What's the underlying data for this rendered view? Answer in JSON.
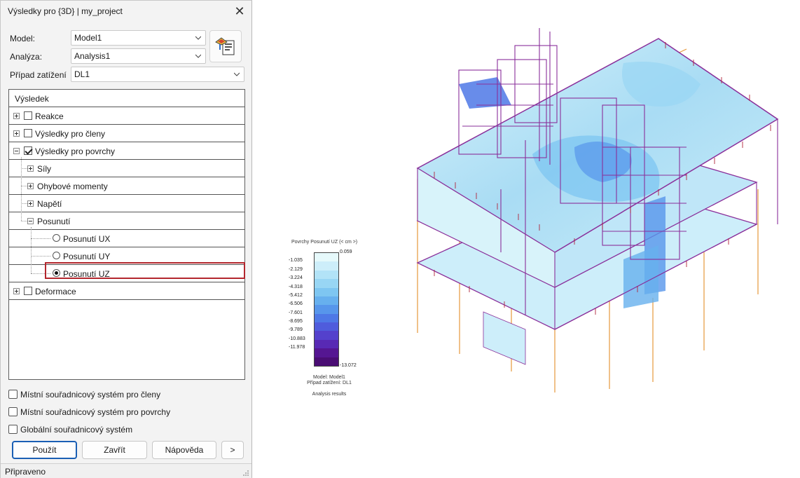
{
  "window": {
    "title": "Výsledky pro {3D} | my_project"
  },
  "form": {
    "model_label": "Model:",
    "model_value": "Model1",
    "analysis_label": "Analýza:",
    "analysis_value": "Analysis1",
    "loadcase_label": "Případ zatížení",
    "loadcase_value": "DL1"
  },
  "tree": {
    "header": "Výsledek",
    "items": [
      {
        "label": "Reakce",
        "checked": false
      },
      {
        "label": "Výsledky pro členy",
        "checked": false
      },
      {
        "label": "Výsledky pro povrchy",
        "checked": true
      },
      {
        "label": "Síly"
      },
      {
        "label": "Ohybové momenty"
      },
      {
        "label": "Napětí"
      },
      {
        "label": "Posunutí"
      },
      {
        "label": "Posunutí UX",
        "selected": false
      },
      {
        "label": "Posunutí UY",
        "selected": false
      },
      {
        "label": "Posunutí UZ",
        "selected": true
      },
      {
        "label": "Deformace",
        "checked": false
      }
    ]
  },
  "options": [
    {
      "label": "Místní souřadnicový systém pro členy",
      "checked": false
    },
    {
      "label": "Místní souřadnicový systém pro povrchy",
      "checked": false
    },
    {
      "label": "Globální souřadnicový systém",
      "checked": false
    }
  ],
  "buttons": {
    "apply": "Použít",
    "close": "Zavřít",
    "help": "Nápověda",
    "more": ">"
  },
  "status": "Připraveno",
  "legend": {
    "title": "Povrchy Posunutí UZ (< cm >)",
    "max": "0.059",
    "min": "-13.072",
    "ticks": [
      "-1.035",
      "-2.129",
      "-3.224",
      "-4.318",
      "-5.412",
      "-6.506",
      "-7.601",
      "-8.695",
      "-9.789",
      "-10.883",
      "-11.978"
    ],
    "colors": [
      "#e6f9fb",
      "#cdeefa",
      "#b2e3f7",
      "#98d6f4",
      "#7ec6f1",
      "#67b0ee",
      "#5796eb",
      "#4e78e6",
      "#4f5cdc",
      "#5441cc",
      "#5829b4",
      "#551692",
      "#4a0d74"
    ],
    "footer_model": "Model: Model1",
    "footer_loadcase": "Případ zatížení: DL1",
    "footer_caption": "Analysis results"
  },
  "colors": {
    "frame": "#8a2f9a",
    "column": "#e7983b",
    "load_arrow": "#b0243a",
    "selection": "#b3262d",
    "accent": "#1a5fb4"
  }
}
